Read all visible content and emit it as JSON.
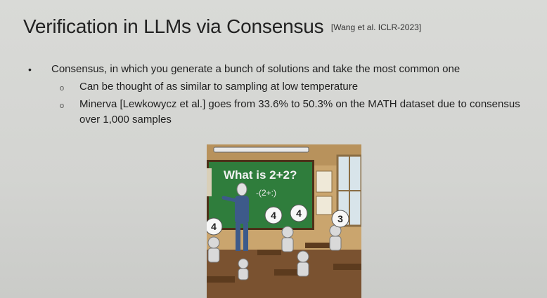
{
  "slide": {
    "title": "Verification in LLMs via Consensus",
    "citation": "[Wang et al. ICLR-2023]",
    "bullets": [
      {
        "text": "Consensus, in which you generate a bunch of solutions and take the most common one",
        "sub": [
          "Can be thought of as similar to sampling at low temperature",
          "Minerva [Lewkowycz et al.] goes from 33.6% to 50.3% on the MATH dataset due to consensus over 1,000 samples"
        ]
      }
    ]
  },
  "illustration": {
    "board_question": "What is 2+2?",
    "board_scribble": "-(2+:)",
    "bubbles": [
      "4",
      "4",
      "4",
      "3"
    ]
  }
}
